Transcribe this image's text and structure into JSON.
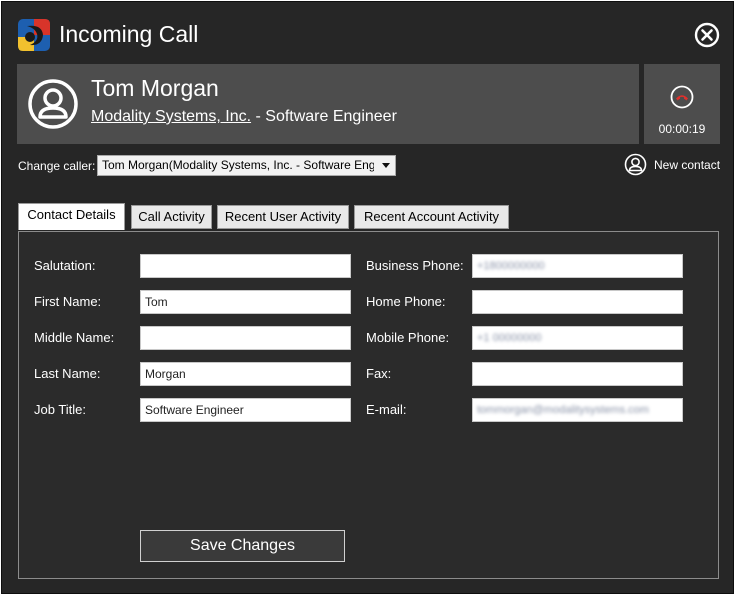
{
  "window": {
    "title": "Incoming Call"
  },
  "caller": {
    "name": "Tom Morgan",
    "company": "Modality Systems, Inc.",
    "role_separator": " - Software Engineer"
  },
  "call": {
    "timer": "00:00:19"
  },
  "change_caller": {
    "label": "Change caller:",
    "selected": "Tom Morgan(Modality Systems, Inc. - Software Engineer)"
  },
  "new_contact": {
    "label": "New contact"
  },
  "tabs": [
    {
      "label": "Contact Details",
      "active": true
    },
    {
      "label": "Call Activity",
      "active": false
    },
    {
      "label": "Recent User Activity",
      "active": false
    },
    {
      "label": "Recent Account Activity",
      "active": false
    }
  ],
  "form": {
    "left": [
      {
        "label": "Salutation:",
        "value": ""
      },
      {
        "label": "First Name:",
        "value": "Tom"
      },
      {
        "label": "Middle Name:",
        "value": ""
      },
      {
        "label": "Last Name:",
        "value": "Morgan"
      },
      {
        "label": "Job Title:",
        "value": "Software Engineer"
      }
    ],
    "right": [
      {
        "label": "Business Phone:",
        "value": "+1800000000"
      },
      {
        "label": "Home Phone:",
        "value": ""
      },
      {
        "label": "Mobile Phone:",
        "value": "+1 00000000"
      },
      {
        "label": "Fax:",
        "value": ""
      },
      {
        "label": "E-mail:",
        "value": "tommorgan@modalitysystems.com"
      }
    ],
    "save_label": "Save Changes"
  },
  "colors": {
    "background": "#262626",
    "panel": "#4d4d4d",
    "hangup_red": "#e0302c"
  }
}
